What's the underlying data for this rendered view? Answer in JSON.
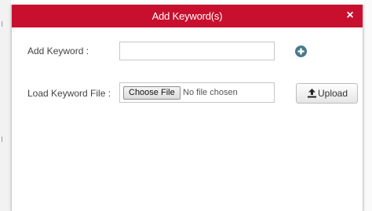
{
  "dialog": {
    "title": "Add Keyword(s)",
    "close_glyph": "×",
    "accent_color": "#c8102e"
  },
  "form": {
    "add_keyword_label": "Add Keyword :",
    "add_keyword_value": "",
    "add_icon": "plus-circle-icon",
    "load_file_label": "Load Keyword File :",
    "choose_file_label": "Choose File",
    "no_file_text": "No file chosen",
    "upload_label": "Upload",
    "upload_icon": "upload-icon"
  }
}
